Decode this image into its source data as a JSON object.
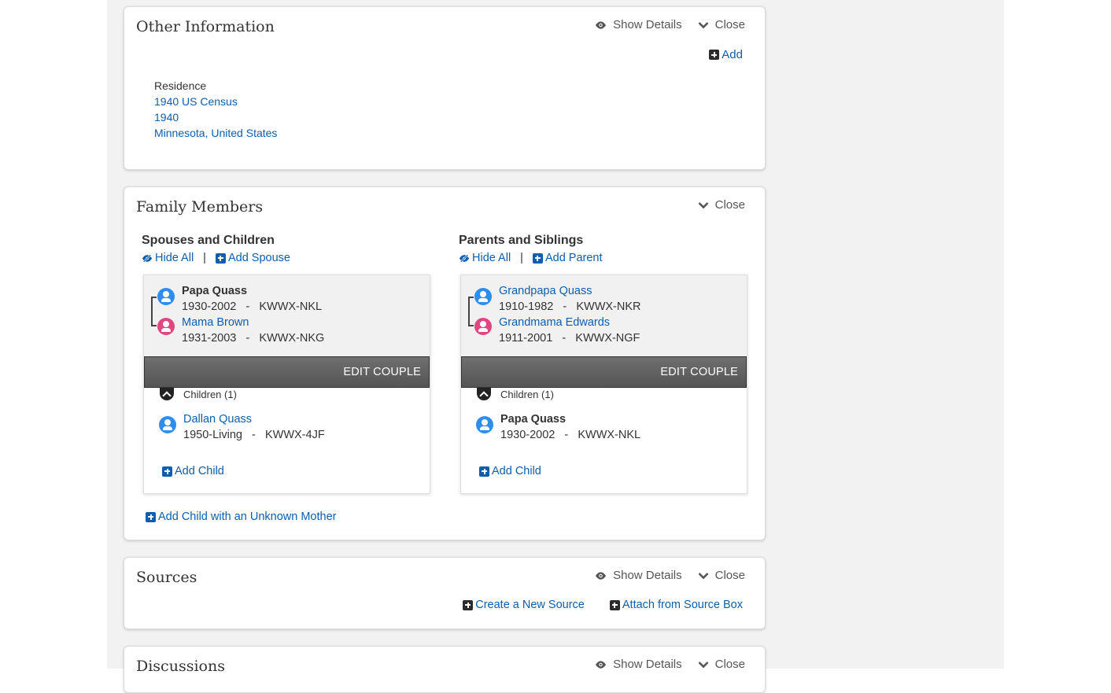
{
  "other_info": {
    "title": "Other Information",
    "show_details": "Show Details",
    "close": "Close",
    "add": "Add",
    "fact": {
      "type": "Residence",
      "source": "1940 US Census",
      "date": "1940",
      "place": "Minnesota, United States"
    }
  },
  "family": {
    "title": "Family Members",
    "close": "Close",
    "spouses": {
      "heading": "Spouses and Children",
      "hide_all": "Hide All",
      "separator": "|",
      "add_spouse": "Add Spouse",
      "husband": {
        "name": "Papa Quass",
        "meta": "1930-2002   -   KWWX-NKL"
      },
      "wife": {
        "name": "Mama Brown",
        "meta": "1931-2003   -   KWWX-NKG"
      },
      "edit_couple": "EDIT COUPLE",
      "children_label": "Children (1)",
      "child": {
        "name": "Dallan Quass",
        "meta": "1950-Living   -   KWWX-4JF"
      },
      "add_child": "Add Child"
    },
    "parents": {
      "heading": "Parents and Siblings",
      "hide_all": "Hide All",
      "separator": "|",
      "add_parent": "Add Parent",
      "father": {
        "name": "Grandpapa Quass",
        "meta": "1910-1982   -   KWWX-NKR"
      },
      "mother": {
        "name": "Grandmama Edwards",
        "meta": "1911-2001   -   KWWX-NGF"
      },
      "edit_couple": "EDIT COUPLE",
      "children_label": "Children (1)",
      "child": {
        "name": "Papa Quass",
        "meta": "1930-2002   -   KWWX-NKL"
      },
      "add_child": "Add Child"
    },
    "add_unknown_mother": "Add Child with an Unknown Mother"
  },
  "sources": {
    "title": "Sources",
    "show_details": "Show Details",
    "close": "Close",
    "create_new": "Create a New Source",
    "attach": "Attach from Source Box"
  },
  "discussions": {
    "title": "Discussions",
    "show_details": "Show Details",
    "close": "Close"
  },
  "colors": {
    "link": "#0d5eaf",
    "male": "#2e8ef0",
    "female": "#e0467f",
    "edit_bar": "#5f5f5f",
    "page_bg": "#f2f2f2"
  },
  "icons": {
    "eye": "eye-icon",
    "chevron": "chevron-down-icon",
    "plus": "plus-square-icon",
    "hide": "eye-slash-icon",
    "male": "male-person-icon",
    "female": "female-person-icon"
  }
}
